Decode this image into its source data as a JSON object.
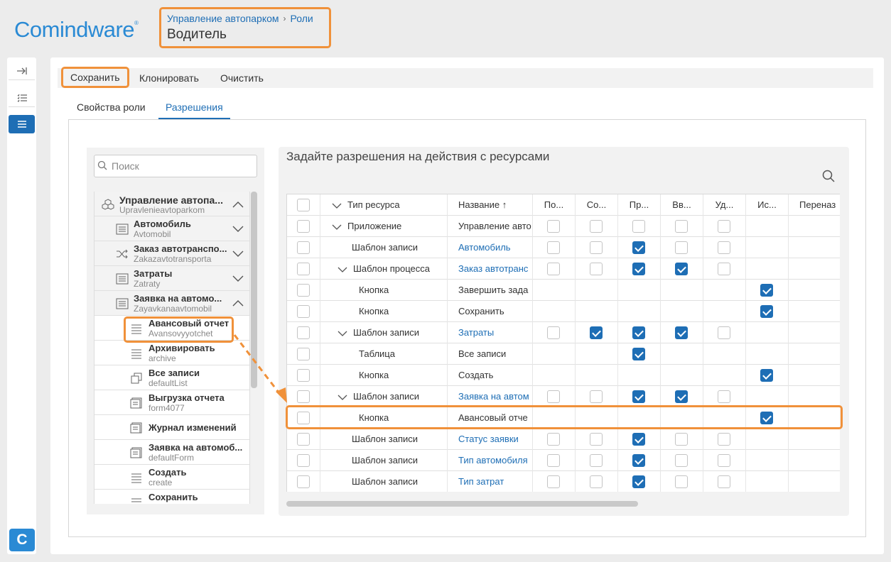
{
  "app": {
    "logo": "Comindware",
    "logo_mark": "®"
  },
  "breadcrumb": {
    "items": [
      "Управление автопарком",
      "Роли"
    ],
    "sep": "›",
    "title": "Водитель"
  },
  "toolbar": {
    "save": "Сохранить",
    "clone": "Клонировать",
    "clear": "Очистить"
  },
  "tabs": {
    "props": "Свойства роли",
    "perms": "Разрешения"
  },
  "search": {
    "placeholder": "Поиск"
  },
  "tree": [
    {
      "title": "Управление автопа...",
      "sub": "Upravlenieavtoparkom"
    },
    {
      "title": "Автомобиль",
      "sub": "Avtomobil"
    },
    {
      "title": "Заказ автотранспо...",
      "sub": "Zakazavtotransporta"
    },
    {
      "title": "Затраты",
      "sub": "Zatraty"
    },
    {
      "title": "Заявка на автомо...",
      "sub": "Zayavkanaavtomobil"
    },
    {
      "title": "Авансовый отчет",
      "sub": "Avansovyyotchet"
    },
    {
      "title": "Архивировать",
      "sub": "archive"
    },
    {
      "title": "Все записи",
      "sub": "defaultList"
    },
    {
      "title": "Выгрузка отчета",
      "sub": "form4077"
    },
    {
      "title": "Журнал изменений",
      "sub": ""
    },
    {
      "title": "Заявка на автомоб...",
      "sub": "defaultForm"
    },
    {
      "title": "Создать",
      "sub": "create"
    },
    {
      "title": "Сохранить",
      "sub": ""
    }
  ],
  "permissions": {
    "title": "Задайте разрешения на действия с ресурсами",
    "headers": [
      "Тип ресурса",
      "Название ↑",
      "По...",
      "Со...",
      "Пр...",
      "Вв...",
      "Уд...",
      "Ис...",
      "Переназ"
    ],
    "rows": [
      {
        "type": "Приложение",
        "name": "Управление авто",
        "link": false,
        "cbs": [
          0,
          0,
          0,
          0,
          0,
          null
        ]
      },
      {
        "type": "Шаблон записи",
        "name": "Автомобиль",
        "link": true,
        "cbs": [
          0,
          0,
          1,
          0,
          0,
          null
        ]
      },
      {
        "type": "Шаблон процесса",
        "name": "Заказ автотранс",
        "link": true,
        "cbs": [
          0,
          0,
          1,
          1,
          0,
          null
        ]
      },
      {
        "type": "Кнопка",
        "name": "Завершить зада",
        "link": false,
        "cbs": [
          null,
          null,
          null,
          null,
          null,
          1
        ]
      },
      {
        "type": "Кнопка",
        "name": "Сохранить",
        "link": false,
        "cbs": [
          null,
          null,
          null,
          null,
          null,
          1
        ]
      },
      {
        "type": "Шаблон записи",
        "name": "Затраты",
        "link": true,
        "cbs": [
          0,
          1,
          1,
          1,
          0,
          null
        ]
      },
      {
        "type": "Таблица",
        "name": "Все записи",
        "link": false,
        "cbs": [
          null,
          null,
          1,
          null,
          null,
          null
        ]
      },
      {
        "type": "Кнопка",
        "name": "Создать",
        "link": false,
        "cbs": [
          null,
          null,
          null,
          null,
          null,
          1
        ]
      },
      {
        "type": "Шаблон записи",
        "name": "Заявка на автом",
        "link": true,
        "cbs": [
          0,
          0,
          1,
          1,
          0,
          null
        ]
      },
      {
        "type": "Кнопка",
        "name": "Авансовый отче",
        "link": false,
        "cbs": [
          null,
          null,
          null,
          null,
          null,
          1
        ]
      },
      {
        "type": "Шаблон записи",
        "name": "Статус заявки",
        "link": true,
        "cbs": [
          0,
          0,
          1,
          0,
          0,
          null
        ]
      },
      {
        "type": "Шаблон записи",
        "name": "Тип автомобиля",
        "link": true,
        "cbs": [
          0,
          0,
          1,
          0,
          0,
          null
        ]
      },
      {
        "type": "Шаблон записи",
        "name": "Тип затрат",
        "link": true,
        "cbs": [
          0,
          0,
          1,
          0,
          0,
          null
        ]
      }
    ]
  },
  "colors": {
    "accent": "#1e6eb5",
    "highlight": "#f0913a"
  }
}
